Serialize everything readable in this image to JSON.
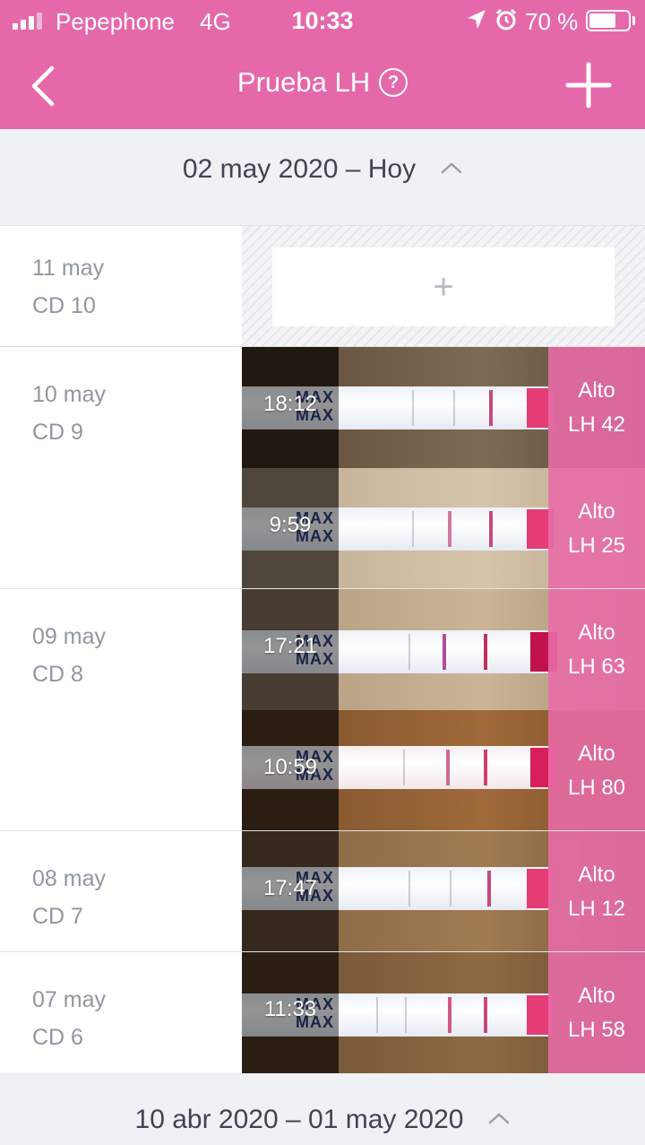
{
  "status_bar": {
    "carrier": "Pepephone",
    "network": "4G",
    "time": "10:33",
    "battery": "70 %",
    "battery_level": 0.7
  },
  "nav": {
    "back_icon": "chevron-left-icon",
    "title": "Prueba LH",
    "help_icon": "question-circle-icon",
    "help_glyph": "?",
    "add_icon": "plus-icon"
  },
  "colors": {
    "accent": "#e569aa",
    "result_bg": "#e96ca8",
    "band": "#c7497f"
  },
  "sections": [
    {
      "range": "02 may 2020 – Hoy",
      "days": [
        {
          "date": "11 may",
          "cycle_day": "CD 10",
          "add_glyph": "+",
          "tests": []
        },
        {
          "date": "10 may",
          "cycle_day": "CD 9",
          "tests": [
            {
              "time": "18:12",
              "level": "Alto",
              "value": "LH 42"
            },
            {
              "time": "9:59",
              "level": "Alto",
              "value": "LH 25"
            }
          ]
        },
        {
          "date": "09 may",
          "cycle_day": "CD 8",
          "tests": [
            {
              "time": "17:21",
              "level": "Alto",
              "value": "LH 63"
            },
            {
              "time": "10:59",
              "level": "Alto",
              "value": "LH 80"
            }
          ]
        },
        {
          "date": "08 may",
          "cycle_day": "CD 7",
          "tests": [
            {
              "time": "17:47",
              "level": "Alto",
              "value": "LH 12"
            }
          ]
        },
        {
          "date": "07 may",
          "cycle_day": "CD 6",
          "tests": [
            {
              "time": "11:33",
              "level": "Alto",
              "value": "LH 58"
            }
          ]
        }
      ]
    },
    {
      "range": "10 abr 2020 – 01 may 2020"
    }
  ],
  "strip_label": "MAX"
}
